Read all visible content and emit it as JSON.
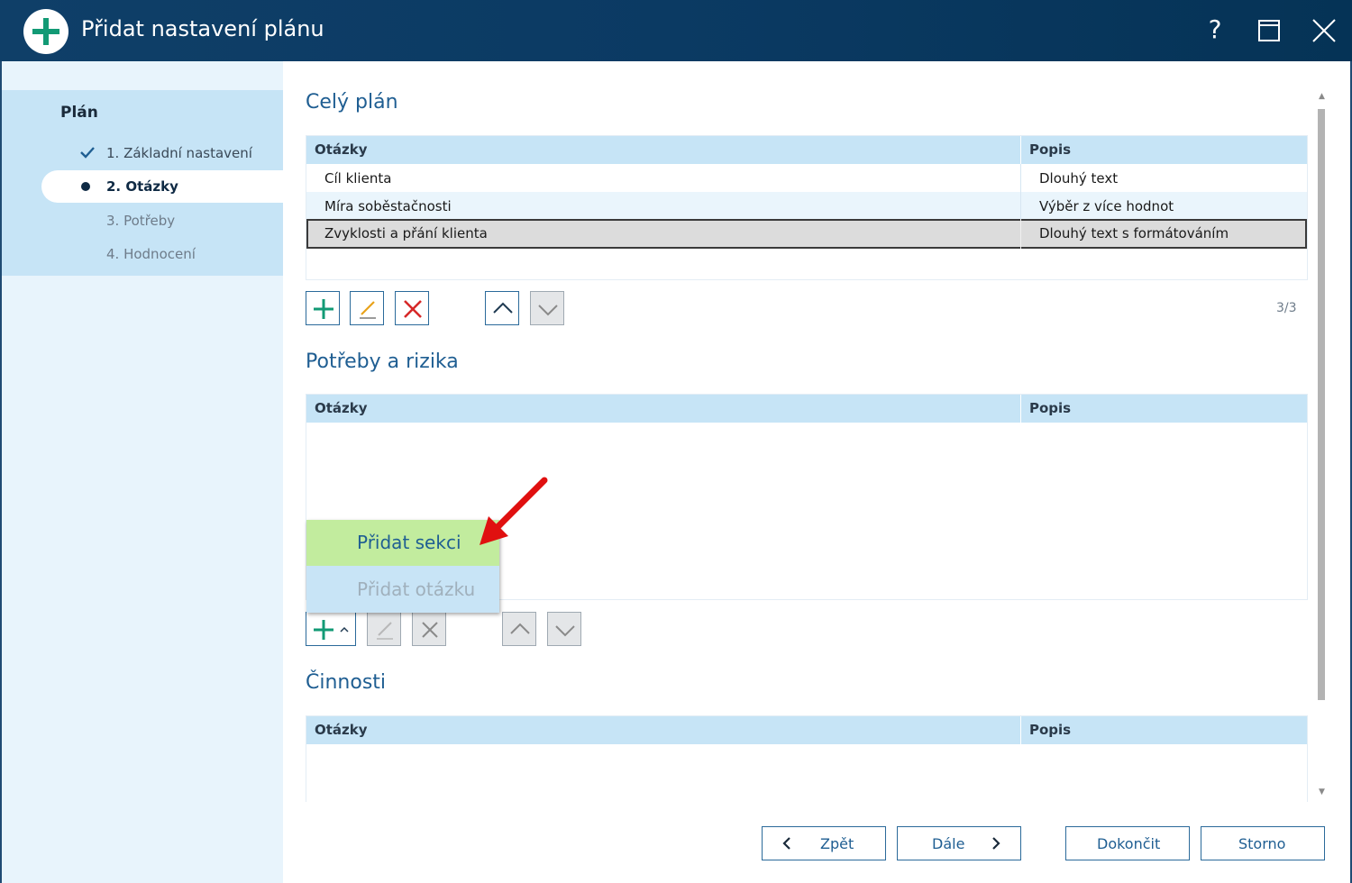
{
  "window": {
    "title": "Přidat nastavení plánu",
    "help_label": "?"
  },
  "sidebar": {
    "title": "Plán",
    "steps": [
      {
        "label": "1. Základní nastavení",
        "state": "done"
      },
      {
        "label": "2. Otázky",
        "state": "active"
      },
      {
        "label": "3. Potřeby",
        "state": "todo"
      },
      {
        "label": "4. Hodnocení",
        "state": "todo"
      }
    ]
  },
  "sections": [
    {
      "title": "Celý plán",
      "columns": [
        "Otázky",
        "Popis"
      ],
      "rows": [
        [
          "Cíl klienta",
          "Dlouhý text"
        ],
        [
          "Míra soběstačnosti",
          "Výběr z více hodnot"
        ],
        [
          "Zvyklosti a přání klienta",
          "Dlouhý text s formátováním"
        ]
      ],
      "selected_row": 2,
      "counter": "3/3"
    },
    {
      "title": "Potřeby a rizika",
      "columns": [
        "Otázky",
        "Popis"
      ],
      "rows": []
    },
    {
      "title": "Činnosti",
      "columns": [
        "Otázky",
        "Popis"
      ],
      "rows": []
    }
  ],
  "add_menu": {
    "items": [
      {
        "label": "Přidat sekci",
        "highlighted": true,
        "enabled": true
      },
      {
        "label": "Přidat otázku",
        "highlighted": false,
        "enabled": false
      }
    ]
  },
  "footer": {
    "back_label": "Zpět",
    "next_label": "Dále",
    "finish_label": "Dokončit",
    "cancel_label": "Storno"
  },
  "colors": {
    "title_bar": "#0b3a63",
    "accent": "#1f5e92",
    "add_green": "#129a75",
    "delete_red": "#d62828",
    "menu_highlight": "#c2ec9e",
    "grid_header": "#c6e4f6",
    "annotation_arrow": "#e01010"
  },
  "icons": [
    "plus-logo-icon",
    "maximize-icon",
    "close-icon",
    "checkmark-icon",
    "plus-icon",
    "edit-icon",
    "delete-icon",
    "chevron-up-icon",
    "chevron-down-icon",
    "chevron-left-icon",
    "chevron-right-icon"
  ]
}
